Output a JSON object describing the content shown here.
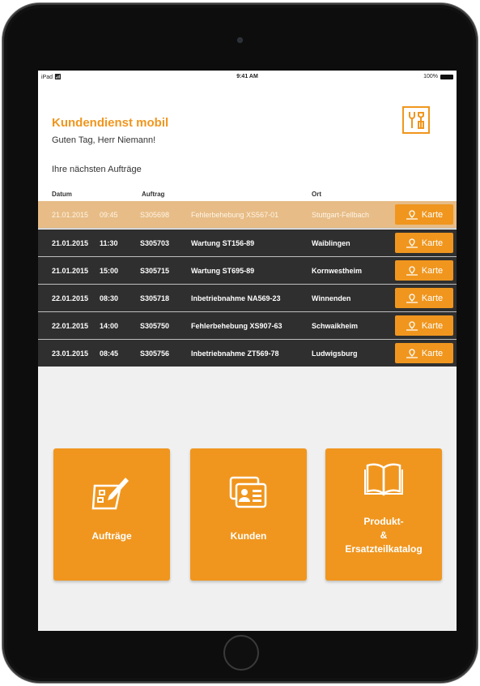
{
  "status_bar": {
    "device": "iPad",
    "time": "9:41 AM",
    "battery": "100%"
  },
  "header": {
    "app_title": "Kundendienst mobil",
    "greeting": "Guten Tag, Herr Niemann!",
    "section_title": "Ihre nächsten Aufträge"
  },
  "columns": {
    "datum": "Datum",
    "auftrag": "Auftrag",
    "ort": "Ort"
  },
  "orders": [
    {
      "date": "21.01.2015",
      "time": "09:45",
      "id": "S305698",
      "desc": "Fehlerbehebung XS567-01",
      "ort": "Stuttgart-Fellbach",
      "button": "Karte",
      "selected": true
    },
    {
      "date": "21.01.2015",
      "time": "11:30",
      "id": "S305703",
      "desc": "Wartung ST156-89",
      "ort": "Waiblingen",
      "button": "Karte"
    },
    {
      "date": "21.01.2015",
      "time": "15:00",
      "id": "S305715",
      "desc": "Wartung ST695-89",
      "ort": "Kornwestheim",
      "button": "Karte"
    },
    {
      "date": "22.01.2015",
      "time": "08:30",
      "id": "S305718",
      "desc": "Inbetriebnahme NA569-23",
      "ort": "Winnenden",
      "button": "Karte"
    },
    {
      "date": "22.01.2015",
      "time": "14:00",
      "id": "S305750",
      "desc": "Fehlerbehebung XS907-63",
      "ort": "Schwaikheim",
      "button": "Karte"
    },
    {
      "date": "23.01.2015",
      "time": "08:45",
      "id": "S305756",
      "desc": "Inbetriebnahme ZT569-78",
      "ort": "Ludwigsburg",
      "button": "Karte"
    }
  ],
  "tiles": {
    "auftraege": {
      "label": "Aufträge",
      "icon": "edit-form-icon"
    },
    "kunden": {
      "label": "Kunden",
      "icon": "contact-cards-icon"
    },
    "katalog": {
      "line1": "Produkt-",
      "line2": "&",
      "line3": "Ersatzteilkatalog",
      "icon": "open-book-icon"
    }
  },
  "colors": {
    "accent": "#f0961e",
    "row_dark": "#2f2f2f",
    "row_selected": "#e7bc86"
  }
}
